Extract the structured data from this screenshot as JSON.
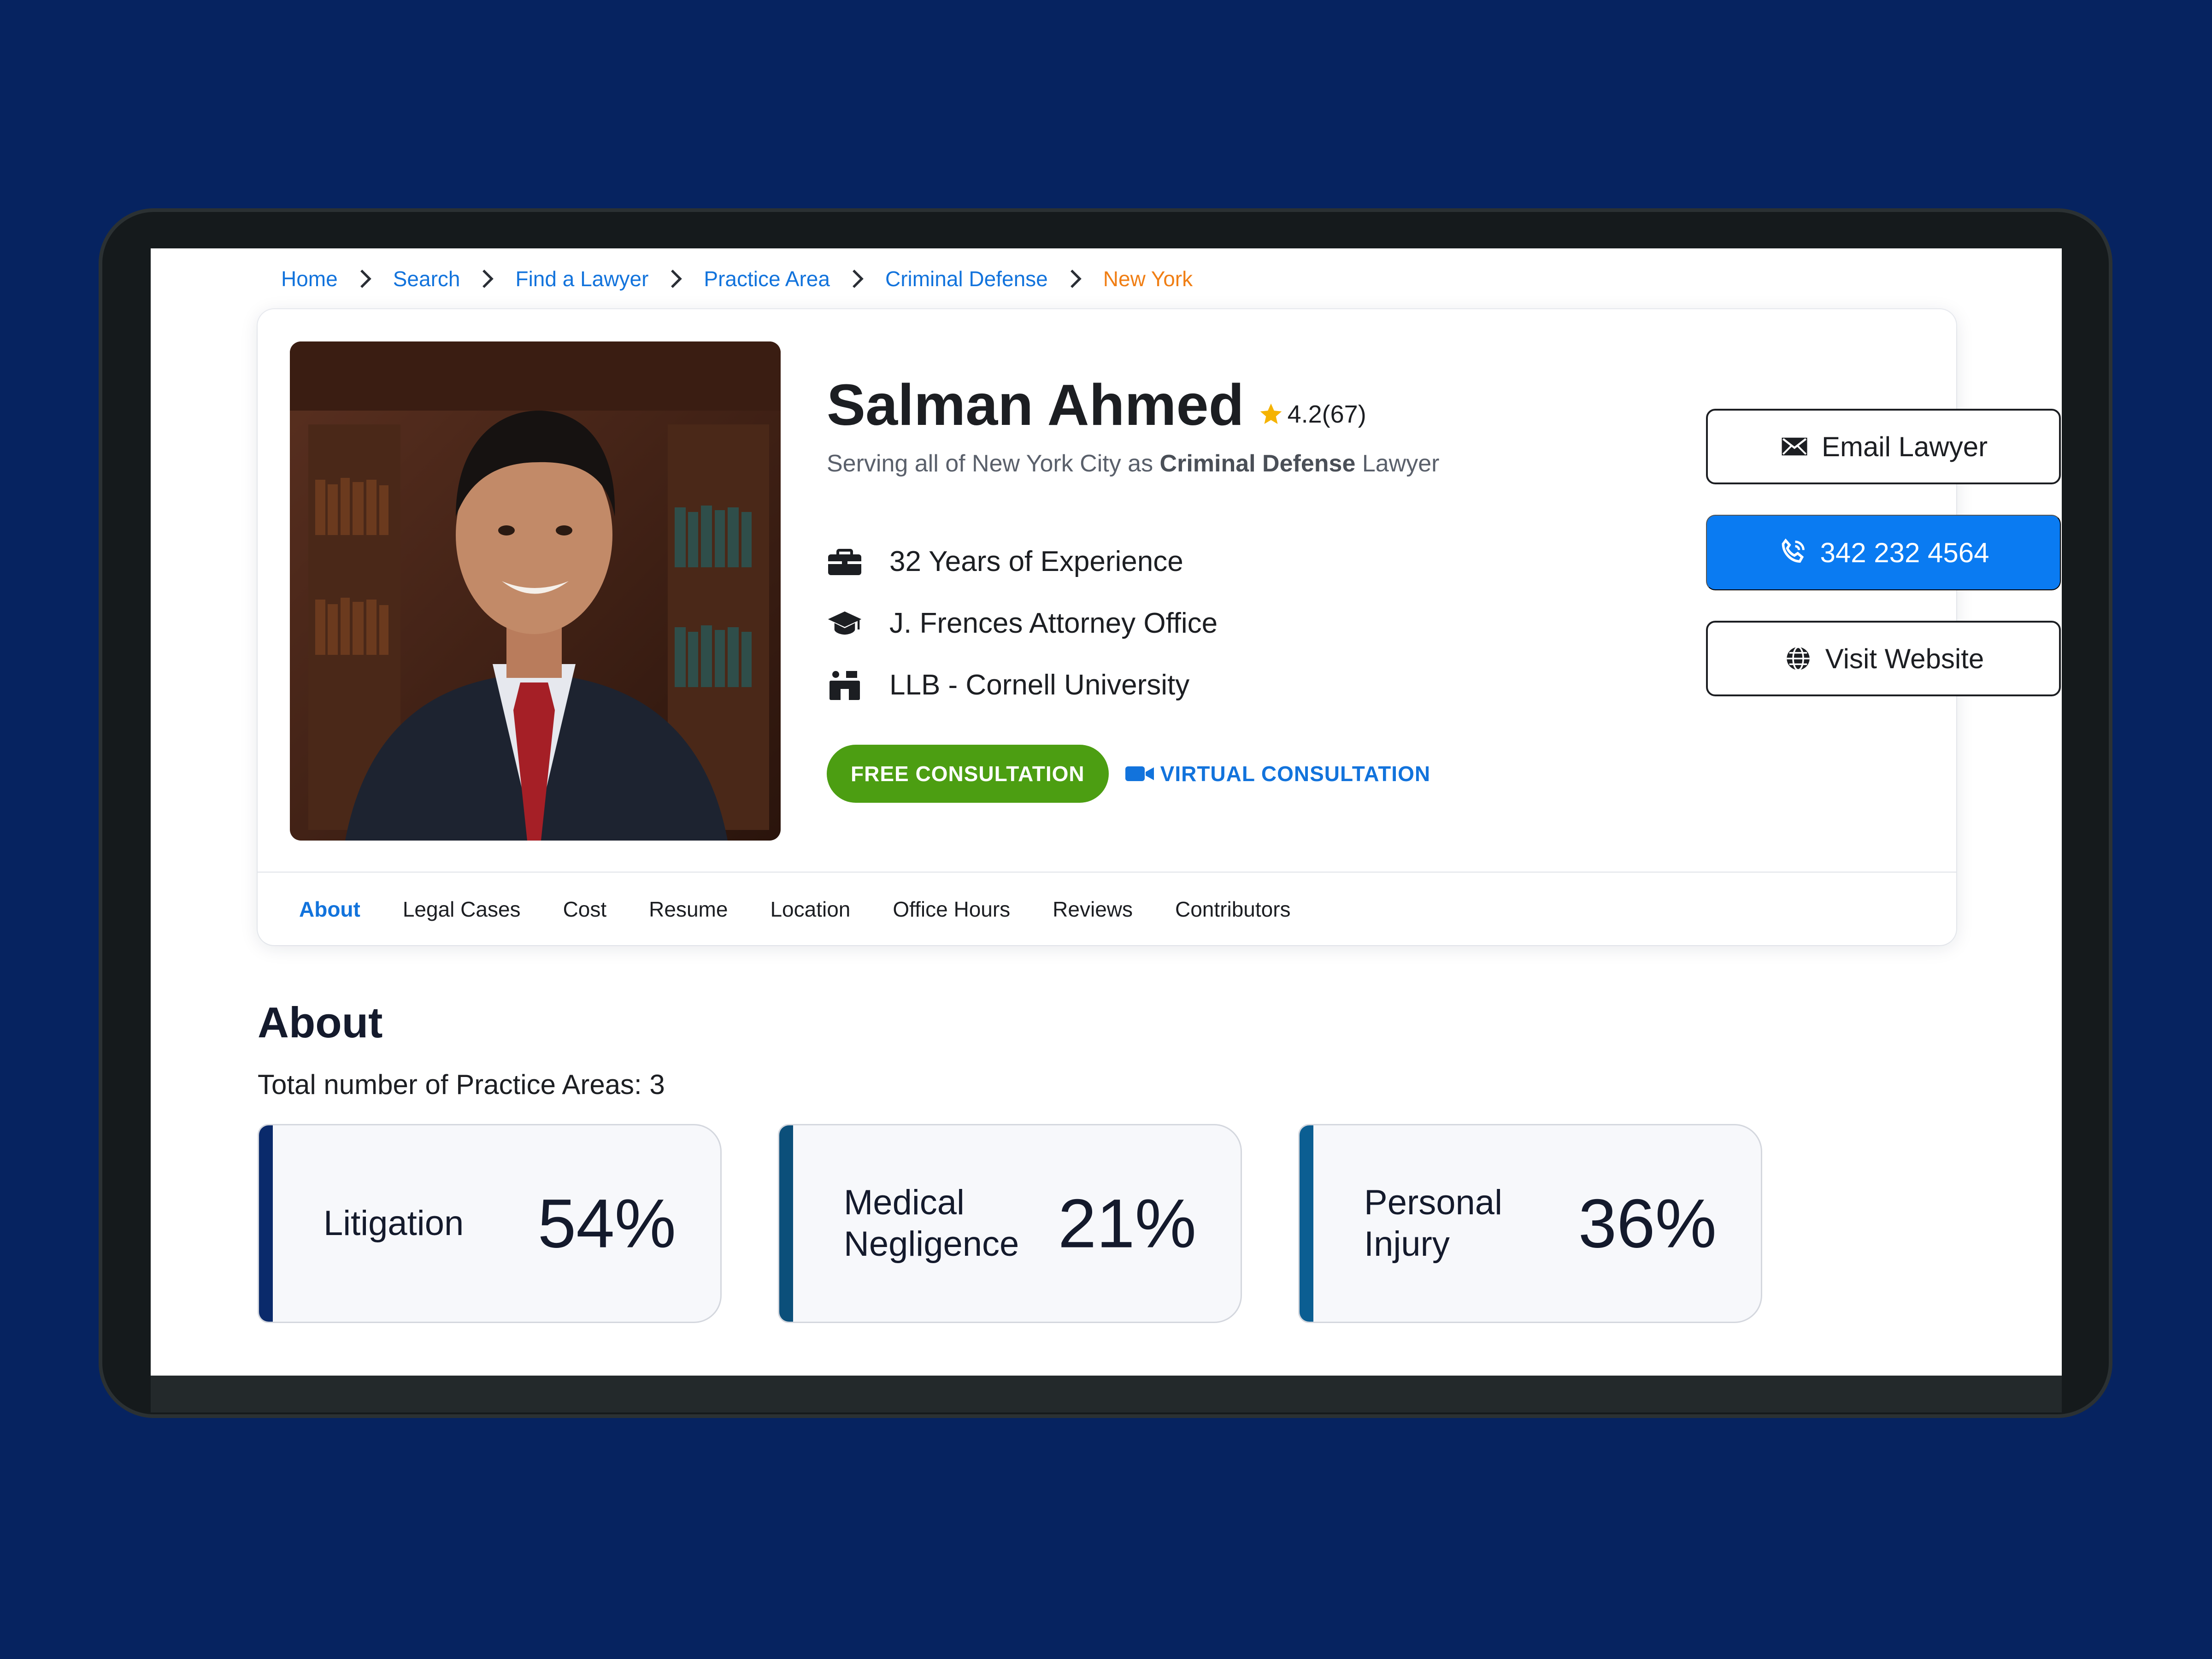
{
  "breadcrumb": {
    "items": [
      "Home",
      "Search",
      "Find a Lawyer",
      "Practice Area",
      "Criminal Defense"
    ],
    "current": "New York"
  },
  "profile": {
    "name": "Salman Ahmed",
    "rating": "4.2(67)",
    "serving_prefix": "Serving all of New York City as",
    "serving_area": "Criminal Defense",
    "serving_suffix": "Lawyer",
    "facts": [
      {
        "icon": "briefcase-icon",
        "text": "32 Years of Experience"
      },
      {
        "icon": "graduation-cap-icon",
        "text": "J. Frences Attorney Office"
      },
      {
        "icon": "school-icon",
        "text": "LLB - Cornell University"
      }
    ],
    "free_consultation": "FREE CONSULTATION",
    "virtual_consultation": "VIRTUAL CONSULTATION"
  },
  "actions": {
    "email": "Email Lawyer",
    "phone": "342 232 4564",
    "website": "Visit Website"
  },
  "tabs": [
    "About",
    "Legal Cases",
    "Cost",
    "Resume",
    "Location",
    "Office Hours",
    "Reviews",
    "Contributors"
  ],
  "active_tab": "About",
  "about": {
    "title": "About",
    "count_text": "Total number of Practice Areas: 3",
    "areas": [
      {
        "name": "Litigation",
        "percent": "54%",
        "accent": "#0a2a6b"
      },
      {
        "name": "Medical Negligence",
        "percent": "21%",
        "accent": "#0b4f7a"
      },
      {
        "name": "Personal Injury",
        "percent": "36%",
        "accent": "#0b5e92"
      }
    ]
  },
  "colors": {
    "page_background": "#062360",
    "link": "#1273dc",
    "breadcrumb_current": "#f07e14",
    "primary_button": "#0a7bf2",
    "free_badge": "#4c9e12",
    "star": "#f5b301"
  }
}
